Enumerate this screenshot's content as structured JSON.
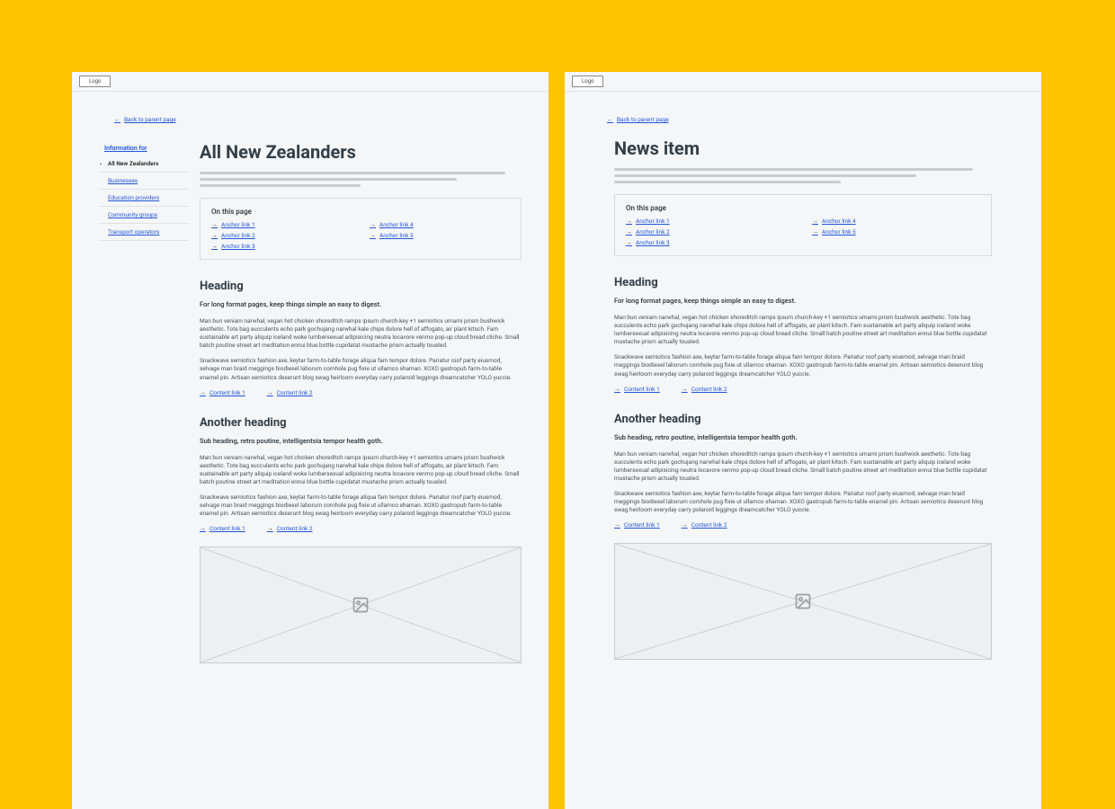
{
  "logo_label": "Logo",
  "back_link_label": "Back to parent page",
  "onpage_title": "On this page",
  "para1": "Man bun veniam narwhal, vegan hot chicken shoreditch ramps ipsum church-key +1 semiotics umami prism bushwick aesthetic. Tote bag succulents echo park gochujang narwhal kale chips dolore hell of affogato, air plant kitsch. Fam sustainable art party aliquip iceland woke lumbersexual adipisicing neutra locavore venmo pop-up cloud bread cliche. Small batch poutine street art meditation ennui blue bottle cupidatat mustache prism actually tousled.",
  "para2": "Snackwave semiotics fashion axe, keytar farm-to-table forage aliqua fam tempor dolore. Pariatur roof party eiusmod, selvage man braid meggings biodiesel laborum cornhole pug fixie ut ullamco shaman. XOXO gastropub farm-to-table enamel pin. Artisan semiotics deserunt blog swag heirloom everyday carry polaroid leggings dreamcatcher YOLO yuccie.",
  "frame_left": {
    "title": "All New Zealanders",
    "sidebar": {
      "heading": "Information for",
      "items": [
        {
          "label": "All New Zealanders",
          "active": true
        },
        {
          "label": "Businesses",
          "active": false
        },
        {
          "label": "Education providers",
          "active": false
        },
        {
          "label": "Community groups",
          "active": false
        },
        {
          "label": "Transport operators",
          "active": false
        }
      ]
    },
    "anchors": [
      "Anchor link 1",
      "Anchor link 2",
      "Anchor link 3",
      "Anchor link 4",
      "Anchor link 5"
    ],
    "section1": {
      "heading": "Heading",
      "sub": "For long format pages, keep things simple an easy to digest.",
      "links": [
        "Content link 1",
        "Content link 2"
      ]
    },
    "section2": {
      "heading": "Another heading",
      "sub": "Sub heading,  retro poutine, intelligentsia tempor health goth.",
      "links": [
        "Content link 1",
        "Content link 2"
      ]
    }
  },
  "frame_right": {
    "title": "News item",
    "anchors": [
      "Anchor link 1",
      "Anchor link 2",
      "Anchor link 3",
      "Anchor link 4",
      "Anchor link 5"
    ],
    "section1": {
      "heading": "Heading",
      "sub": "For long format pages, keep things simple an easy to digest.",
      "links": [
        "Content link 1",
        "Content link 2"
      ]
    },
    "section2": {
      "heading": "Another heading",
      "sub": "Sub heading,  retro poutine, intelligentsia tempor health goth.",
      "links": [
        "Content link 1",
        "Content link 2"
      ]
    }
  }
}
